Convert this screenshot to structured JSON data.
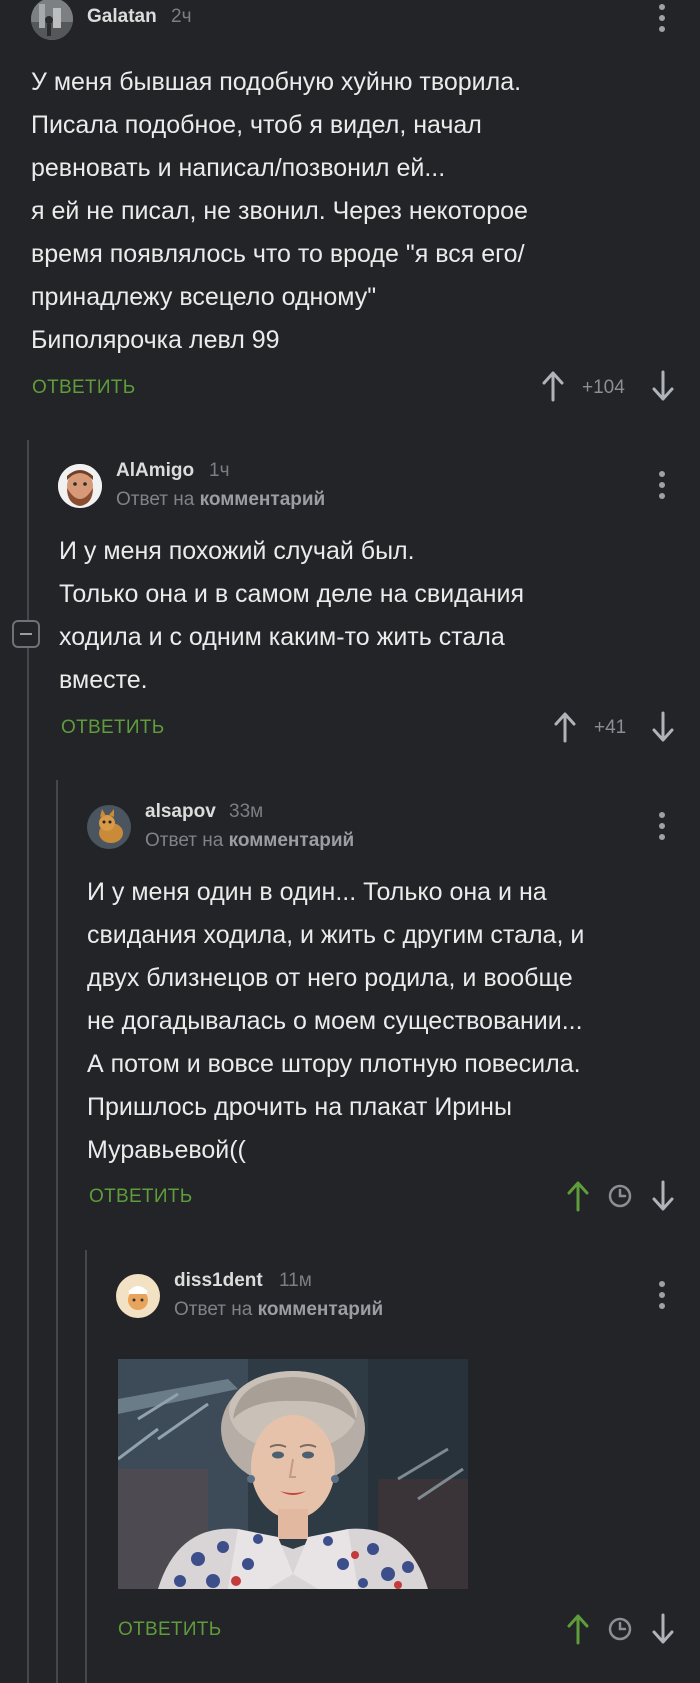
{
  "comments": [
    {
      "user": "Galatan",
      "time": "2ч",
      "text": "У меня бывшая подобную хуйню творила.\nПисала подобное, чтоб я видел, начал\nревновать и написал/позвонил ей...\nя ей не писал, не звонил. Через некоторое\nвремя появлялось что то вроде \"я вся его/\nпринадлежу всецело одному\"\nБиполярочка левл 99",
      "reply_label": "ОТВЕТИТЬ",
      "score": "+104"
    },
    {
      "user": "AlAmigo",
      "time": "1ч",
      "reply_prefix": "Ответ на",
      "reply_target": "комментарий",
      "text": "И у меня похожий случай был.\nТолько она и в самом деле на свидания\nходила и с одним каким-то жить стала\nвместе.",
      "reply_label": "ОТВЕТИТЬ",
      "score": "+41"
    },
    {
      "user": "alsapov",
      "time": "33м",
      "reply_prefix": "Ответ на",
      "reply_target": "комментарий",
      "text": "И у меня один в один... Только она и на\nсвидания ходила, и жить с другим стала, и\nдвух близнецов от него родила, и вообще\nне догадывалась о моем существовании...\nА потом и вовсе штору плотную повесила.\nПришлось дрочить на плакат Ирины\nМуравьевой((",
      "reply_label": "ОТВЕТИТЬ"
    },
    {
      "user": "diss1dent",
      "time": "11м",
      "reply_prefix": "Ответ на",
      "reply_target": "комментарий",
      "image": "photo-woman-portrait",
      "reply_label": "ОТВЕТИТЬ"
    }
  ],
  "colors": {
    "background": "#222427",
    "accent_green": "#5f9c3b",
    "muted": "#7b7e83"
  },
  "icons": [
    "more-vertical-icon",
    "arrow-up-icon",
    "arrow-down-icon",
    "clock-icon",
    "collapse-minus-icon"
  ]
}
